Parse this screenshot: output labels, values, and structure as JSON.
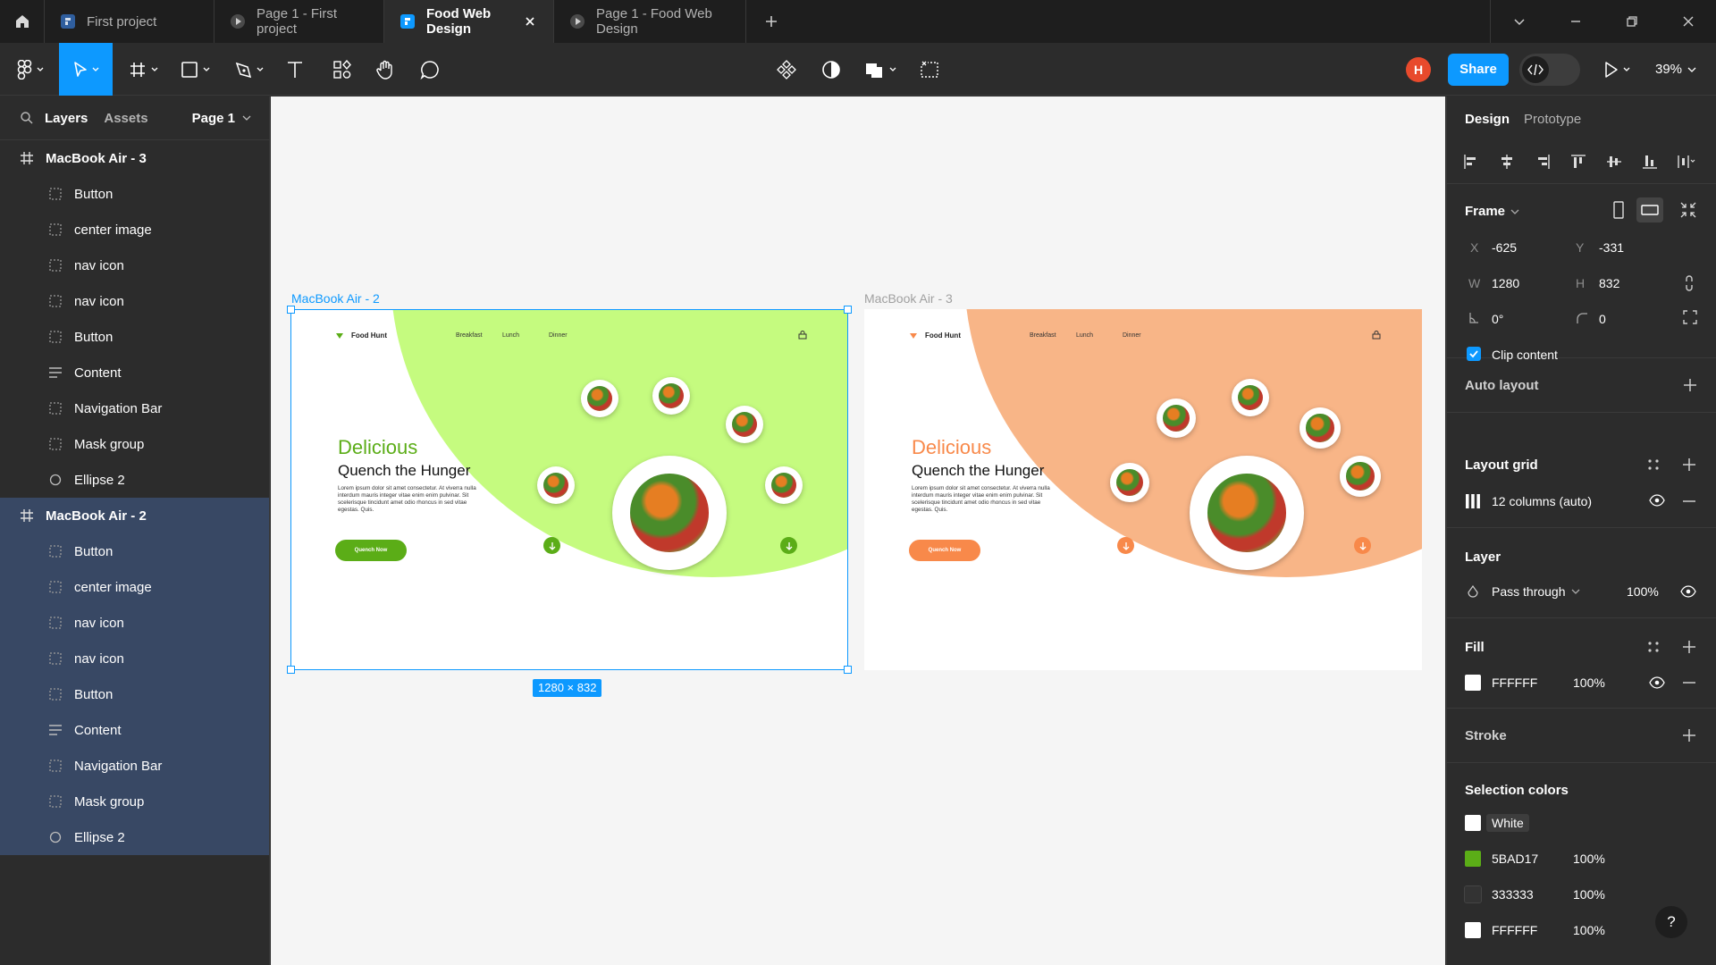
{
  "tabs": [
    {
      "label": "First project",
      "icon": "figma-file-icon",
      "active": false
    },
    {
      "label": "Page 1 - First project",
      "icon": "play-icon",
      "active": false
    },
    {
      "label": "Food Web Design",
      "icon": "figma-file-icon",
      "active": true
    },
    {
      "label": "Page 1 - Food Web Design",
      "icon": "play-icon",
      "active": false
    }
  ],
  "toolbar": {
    "avatar_initial": "H",
    "share_label": "Share",
    "zoom": "39%"
  },
  "left_panel": {
    "tab_layers": "Layers",
    "tab_assets": "Assets",
    "page_label": "Page 1",
    "frames": [
      {
        "name": "MacBook Air - 3",
        "children": [
          {
            "name": "Button",
            "icon": "dotted-frame-icon"
          },
          {
            "name": "center image",
            "icon": "dotted-frame-icon"
          },
          {
            "name": "nav icon",
            "icon": "dotted-frame-icon"
          },
          {
            "name": "nav icon",
            "icon": "dotted-frame-icon"
          },
          {
            "name": "Button",
            "icon": "dotted-frame-icon"
          },
          {
            "name": "Content",
            "icon": "text-lines-icon"
          },
          {
            "name": "Navigation Bar",
            "icon": "dotted-frame-icon"
          },
          {
            "name": "Mask group",
            "icon": "dotted-frame-icon"
          },
          {
            "name": "Ellipse 2",
            "icon": "ellipse-icon"
          }
        ]
      },
      {
        "name": "MacBook Air - 2",
        "children": [
          {
            "name": "Button",
            "icon": "dotted-frame-icon"
          },
          {
            "name": "center image",
            "icon": "dotted-frame-icon"
          },
          {
            "name": "nav icon",
            "icon": "dotted-frame-icon"
          },
          {
            "name": "nav icon",
            "icon": "dotted-frame-icon"
          },
          {
            "name": "Button",
            "icon": "dotted-frame-icon"
          },
          {
            "name": "Content",
            "icon": "text-lines-icon"
          },
          {
            "name": "Navigation Bar",
            "icon": "dotted-frame-icon"
          },
          {
            "name": "Mask group",
            "icon": "dotted-frame-icon"
          },
          {
            "name": "Ellipse 2",
            "icon": "ellipse-icon"
          }
        ]
      }
    ]
  },
  "canvas": {
    "frame2_label": "MacBook Air - 2",
    "frame3_label": "MacBook Air - 3",
    "size_badge": "1280 × 832",
    "design": {
      "brand": "Food Hunt",
      "nav": [
        "Breakfast",
        "Lunch",
        "Dinner"
      ],
      "headline": "Delicious",
      "subheadline": "Quench the Hunger",
      "body": "Lorem ipsum dolor sit amet consectetur. At viverra nulla interdum mauris integer vitae enim enim pulvinar. Sit scelerisque tincidunt amet odio rhoncus in sed vitae egestas. Quis.",
      "button": "Quench Now",
      "green": "#5BAD17",
      "green_bg": "#C5FB7F",
      "orange": "#F8894A",
      "orange_bg": "#F8B587"
    }
  },
  "right_panel": {
    "tab_design": "Design",
    "tab_prototype": "Prototype",
    "frame_label": "Frame",
    "x_label": "X",
    "x": "-625",
    "y_label": "Y",
    "y": "-331",
    "w_label": "W",
    "w": "1280",
    "h_label": "H",
    "h": "832",
    "rotation": "0°",
    "radius": "0",
    "clip_content": "Clip content",
    "auto_layout": "Auto layout",
    "layout_grid": "Layout grid",
    "grid_value": "12 columns (auto)",
    "layer": "Layer",
    "blend": "Pass through",
    "layer_opacity": "100%",
    "fill": "Fill",
    "fill_hex": "FFFFFF",
    "fill_opacity": "100%",
    "stroke": "Stroke",
    "selection_colors": "Selection colors",
    "colors": [
      {
        "hex": "#FFFFFF",
        "label": "White",
        "opacity": ""
      },
      {
        "hex": "#5BAD17",
        "label": "5BAD17",
        "opacity": "100%"
      },
      {
        "hex": "#333333",
        "label": "333333",
        "opacity": "100%"
      },
      {
        "hex": "#FFFFFF",
        "label": "FFFFFF",
        "opacity": "100%"
      }
    ],
    "help": "?"
  }
}
